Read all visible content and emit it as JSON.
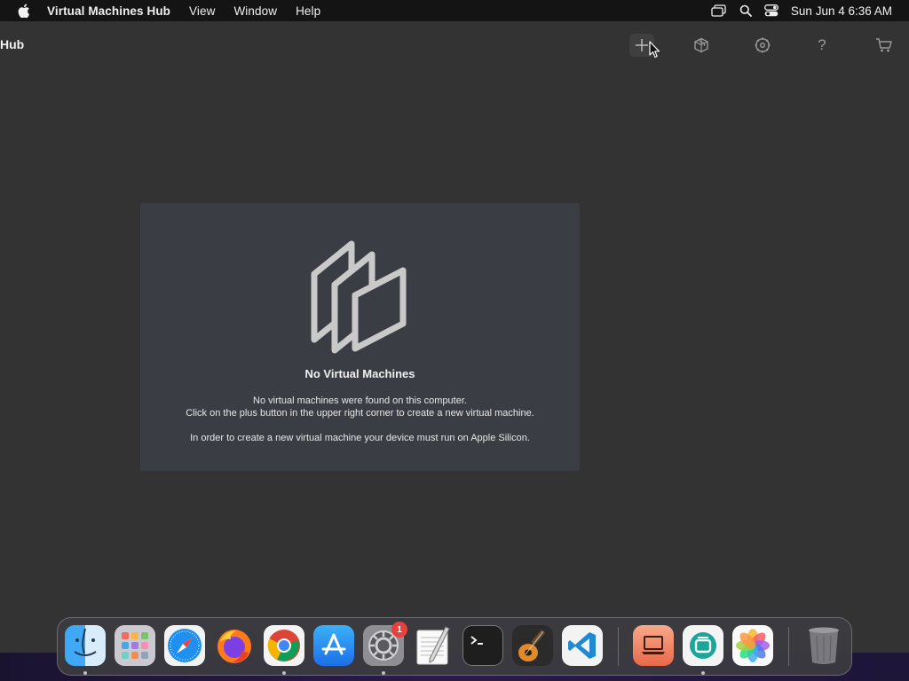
{
  "menubar": {
    "app_name": "Virtual Machines Hub",
    "items": [
      "View",
      "Window",
      "Help"
    ],
    "clock": "Sun Jun 4  6:36 AM"
  },
  "window": {
    "title": "Hub"
  },
  "toolbar": {
    "help_glyph": "?"
  },
  "empty_state": {
    "title": "No Virtual Machines",
    "line1": "No virtual machines were found on this computer.",
    "line2": "Click on the plus button in the upper right corner to create a new virtual machine.",
    "line3": "In order to create a new virtual machine your device must run on Apple Silicon."
  },
  "dock": {
    "settings_badge": "1"
  },
  "colors": {
    "window_bg": "#333333",
    "panel_bg": "#3a3d44",
    "menubar_bg": "#141414",
    "badge": "#e8413b"
  }
}
